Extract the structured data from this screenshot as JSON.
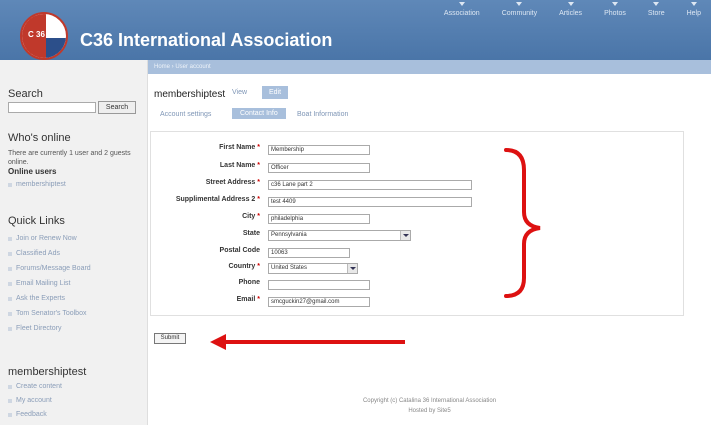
{
  "header": {
    "site_title": "C36 International Association",
    "logo_text": "C 36",
    "nav": [
      "Association",
      "Community",
      "Articles",
      "Photos",
      "Store",
      "Help"
    ]
  },
  "breadcrumb": "Home › User account",
  "sidebar": {
    "search_heading": "Search",
    "search_button": "Search",
    "whos_online_heading": "Who's online",
    "whos_online_text": "There are currently 1 user and 2 guests online.",
    "online_users_heading": "Online users",
    "online_users": [
      "membershiptest"
    ],
    "quick_links_heading": "Quick Links",
    "quick_links": [
      "Join or Renew Now",
      "Classified Ads",
      "Forums/Message Board",
      "Email Mailing List",
      "Ask the Experts",
      "Tom Senator's Toolbox",
      "Fleet Directory"
    ],
    "user_heading": "membershiptest",
    "user_links": [
      "Create content",
      "My account",
      "Feedback"
    ]
  },
  "main": {
    "user_title": "membershiptest",
    "tab_view": "View",
    "tab_edit": "Edit",
    "subtabs": [
      "Account settings",
      "Contact Info",
      "Boat Information"
    ],
    "fields": {
      "first_name": {
        "label": "First Name",
        "value": "Membership"
      },
      "last_name": {
        "label": "Last Name",
        "value": "Officer"
      },
      "street": {
        "label": "Street Address",
        "value": "c36 Lane part 2"
      },
      "street2": {
        "label": "Supplimental Address 2",
        "value": "test 4409"
      },
      "city": {
        "label": "City",
        "value": "philadelphia"
      },
      "state": {
        "label": "State",
        "value": "Pennsylvania"
      },
      "postal": {
        "label": "Postal Code",
        "value": "10063"
      },
      "country": {
        "label": "Country",
        "value": "United States"
      },
      "phone": {
        "label": "Phone",
        "value": ""
      },
      "email": {
        "label": "Email",
        "value": "smcguckin27@gmail.com"
      }
    },
    "required_mark": "*",
    "submit_label": "Submit"
  },
  "footer": {
    "copyright": "Copyright (c) Catalina 36 International Association",
    "hosted": "Hosted by Site5"
  },
  "colors": {
    "header_blue": "#4a75a8",
    "tab_blue": "#a8bfdc",
    "annotation_red": "#dd1111",
    "required_red": "#cc0000"
  }
}
